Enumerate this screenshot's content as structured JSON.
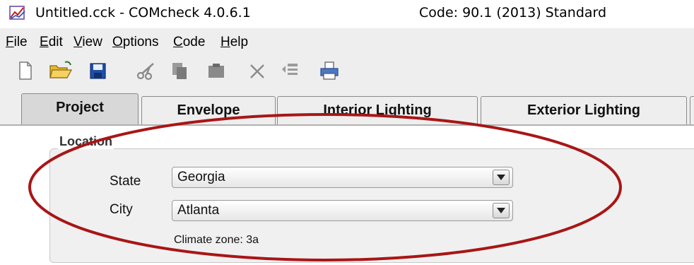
{
  "window": {
    "title": "Untitled.cck - COMcheck 4.0.6.1",
    "code_standard": "Code: 90.1 (2013) Standard"
  },
  "menu": {
    "items": [
      {
        "accel": "F",
        "rest": "ile"
      },
      {
        "accel": "E",
        "rest": "dit"
      },
      {
        "accel": "V",
        "rest": "iew"
      },
      {
        "accel": "O",
        "rest": "ptions"
      },
      {
        "accel": "C",
        "rest": "ode"
      },
      {
        "accel": "H",
        "rest": "elp"
      }
    ]
  },
  "toolbar": {
    "buttons": [
      "new-icon",
      "open-icon",
      "save-icon",
      "cut-icon",
      "copy-icon",
      "paste-icon",
      "delete-icon",
      "list-icon",
      "print-icon"
    ]
  },
  "tabs": [
    {
      "label": "Project",
      "active": true
    },
    {
      "label": "Envelope",
      "active": false
    },
    {
      "label": "Interior Lighting",
      "active": false
    },
    {
      "label": "Exterior Lighting",
      "active": false
    }
  ],
  "location": {
    "group_label": "Location",
    "state_label": "State",
    "state_value": "Georgia",
    "city_label": "City",
    "city_value": "Atlanta",
    "climate_zone": "Climate zone: 3a"
  },
  "colors": {
    "annotation_ellipse": "#a81616",
    "save_blue": "#1f4fa8",
    "folder_yellow": "#e8b830"
  }
}
